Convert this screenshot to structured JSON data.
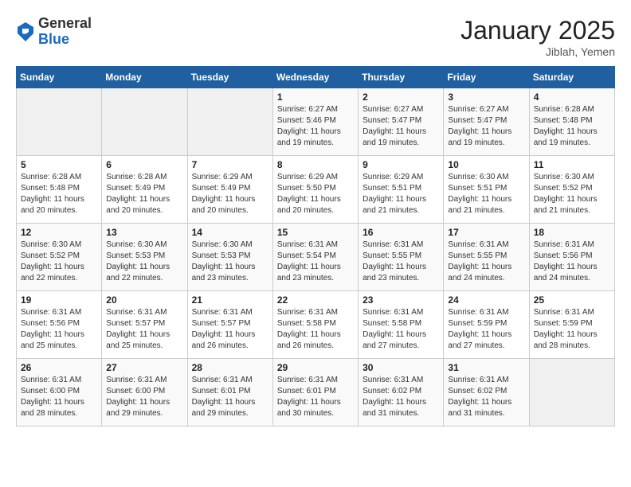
{
  "header": {
    "logo_general": "General",
    "logo_blue": "Blue",
    "month_year": "January 2025",
    "location": "Jiblah, Yemen"
  },
  "days_of_week": [
    "Sunday",
    "Monday",
    "Tuesday",
    "Wednesday",
    "Thursday",
    "Friday",
    "Saturday"
  ],
  "weeks": [
    [
      {
        "day": "",
        "info": ""
      },
      {
        "day": "",
        "info": ""
      },
      {
        "day": "",
        "info": ""
      },
      {
        "day": "1",
        "info": "Sunrise: 6:27 AM\nSunset: 5:46 PM\nDaylight: 11 hours and 19 minutes."
      },
      {
        "day": "2",
        "info": "Sunrise: 6:27 AM\nSunset: 5:47 PM\nDaylight: 11 hours and 19 minutes."
      },
      {
        "day": "3",
        "info": "Sunrise: 6:27 AM\nSunset: 5:47 PM\nDaylight: 11 hours and 19 minutes."
      },
      {
        "day": "4",
        "info": "Sunrise: 6:28 AM\nSunset: 5:48 PM\nDaylight: 11 hours and 19 minutes."
      }
    ],
    [
      {
        "day": "5",
        "info": "Sunrise: 6:28 AM\nSunset: 5:48 PM\nDaylight: 11 hours and 20 minutes."
      },
      {
        "day": "6",
        "info": "Sunrise: 6:28 AM\nSunset: 5:49 PM\nDaylight: 11 hours and 20 minutes."
      },
      {
        "day": "7",
        "info": "Sunrise: 6:29 AM\nSunset: 5:49 PM\nDaylight: 11 hours and 20 minutes."
      },
      {
        "day": "8",
        "info": "Sunrise: 6:29 AM\nSunset: 5:50 PM\nDaylight: 11 hours and 20 minutes."
      },
      {
        "day": "9",
        "info": "Sunrise: 6:29 AM\nSunset: 5:51 PM\nDaylight: 11 hours and 21 minutes."
      },
      {
        "day": "10",
        "info": "Sunrise: 6:30 AM\nSunset: 5:51 PM\nDaylight: 11 hours and 21 minutes."
      },
      {
        "day": "11",
        "info": "Sunrise: 6:30 AM\nSunset: 5:52 PM\nDaylight: 11 hours and 21 minutes."
      }
    ],
    [
      {
        "day": "12",
        "info": "Sunrise: 6:30 AM\nSunset: 5:52 PM\nDaylight: 11 hours and 22 minutes."
      },
      {
        "day": "13",
        "info": "Sunrise: 6:30 AM\nSunset: 5:53 PM\nDaylight: 11 hours and 22 minutes."
      },
      {
        "day": "14",
        "info": "Sunrise: 6:30 AM\nSunset: 5:53 PM\nDaylight: 11 hours and 23 minutes."
      },
      {
        "day": "15",
        "info": "Sunrise: 6:31 AM\nSunset: 5:54 PM\nDaylight: 11 hours and 23 minutes."
      },
      {
        "day": "16",
        "info": "Sunrise: 6:31 AM\nSunset: 5:55 PM\nDaylight: 11 hours and 23 minutes."
      },
      {
        "day": "17",
        "info": "Sunrise: 6:31 AM\nSunset: 5:55 PM\nDaylight: 11 hours and 24 minutes."
      },
      {
        "day": "18",
        "info": "Sunrise: 6:31 AM\nSunset: 5:56 PM\nDaylight: 11 hours and 24 minutes."
      }
    ],
    [
      {
        "day": "19",
        "info": "Sunrise: 6:31 AM\nSunset: 5:56 PM\nDaylight: 11 hours and 25 minutes."
      },
      {
        "day": "20",
        "info": "Sunrise: 6:31 AM\nSunset: 5:57 PM\nDaylight: 11 hours and 25 minutes."
      },
      {
        "day": "21",
        "info": "Sunrise: 6:31 AM\nSunset: 5:57 PM\nDaylight: 11 hours and 26 minutes."
      },
      {
        "day": "22",
        "info": "Sunrise: 6:31 AM\nSunset: 5:58 PM\nDaylight: 11 hours and 26 minutes."
      },
      {
        "day": "23",
        "info": "Sunrise: 6:31 AM\nSunset: 5:58 PM\nDaylight: 11 hours and 27 minutes."
      },
      {
        "day": "24",
        "info": "Sunrise: 6:31 AM\nSunset: 5:59 PM\nDaylight: 11 hours and 27 minutes."
      },
      {
        "day": "25",
        "info": "Sunrise: 6:31 AM\nSunset: 5:59 PM\nDaylight: 11 hours and 28 minutes."
      }
    ],
    [
      {
        "day": "26",
        "info": "Sunrise: 6:31 AM\nSunset: 6:00 PM\nDaylight: 11 hours and 28 minutes."
      },
      {
        "day": "27",
        "info": "Sunrise: 6:31 AM\nSunset: 6:00 PM\nDaylight: 11 hours and 29 minutes."
      },
      {
        "day": "28",
        "info": "Sunrise: 6:31 AM\nSunset: 6:01 PM\nDaylight: 11 hours and 29 minutes."
      },
      {
        "day": "29",
        "info": "Sunrise: 6:31 AM\nSunset: 6:01 PM\nDaylight: 11 hours and 30 minutes."
      },
      {
        "day": "30",
        "info": "Sunrise: 6:31 AM\nSunset: 6:02 PM\nDaylight: 11 hours and 31 minutes."
      },
      {
        "day": "31",
        "info": "Sunrise: 6:31 AM\nSunset: 6:02 PM\nDaylight: 11 hours and 31 minutes."
      },
      {
        "day": "",
        "info": ""
      }
    ]
  ]
}
